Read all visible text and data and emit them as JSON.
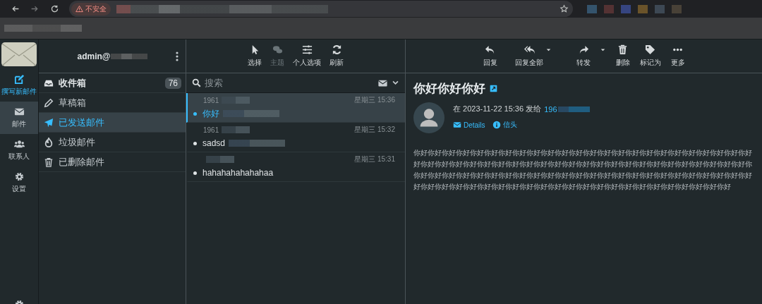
{
  "browser": {
    "security_label": "不安全"
  },
  "nav": [
    {
      "label": "撰写新邮件",
      "kind": "compose",
      "selected": false
    },
    {
      "label": "邮件",
      "kind": "mail",
      "selected": true
    },
    {
      "label": "联系人",
      "kind": "contacts",
      "selected": false
    },
    {
      "label": "设置",
      "kind": "settings",
      "selected": false
    }
  ],
  "account": "admin@",
  "folders": [
    {
      "label": "收件箱",
      "kind": "inbox",
      "count": "76",
      "unread": true,
      "selected": false
    },
    {
      "label": "草稿箱",
      "kind": "drafts",
      "unread": false,
      "selected": false
    },
    {
      "label": "已发送邮件",
      "kind": "sent",
      "unread": false,
      "selected": true
    },
    {
      "label": "垃圾邮件",
      "kind": "junk",
      "unread": false,
      "selected": false
    },
    {
      "label": "已删除邮件",
      "kind": "trash",
      "unread": false,
      "selected": false
    }
  ],
  "list_toolbar": [
    {
      "label": "选择",
      "kind": "select",
      "disabled": false
    },
    {
      "label": "主题",
      "kind": "threads",
      "disabled": true
    },
    {
      "label": "个人选项",
      "kind": "options",
      "disabled": false
    },
    {
      "label": "刷新",
      "kind": "refresh",
      "disabled": false
    }
  ],
  "search": {
    "placeholder": "搜索"
  },
  "messages": [
    {
      "from": "1961",
      "date": "星期三 15:36",
      "subject": "你好",
      "selected": true
    },
    {
      "from": "1961",
      "date": "星期三 15:32",
      "subject": "sadsd",
      "selected": false
    },
    {
      "date": "星期三 15:31",
      "subject": "hahahahahahahaa",
      "selected": false
    }
  ],
  "message_toolbar": [
    {
      "label": "回复",
      "kind": "reply",
      "dropdown": false
    },
    {
      "label": "回复全部",
      "kind": "reply-all",
      "dropdown": true
    },
    {
      "label": "转发",
      "kind": "forward",
      "dropdown": true
    },
    {
      "label": "删除",
      "kind": "delete",
      "dropdown": false
    },
    {
      "label": "标记为",
      "kind": "tag",
      "dropdown": false
    },
    {
      "label": "更多",
      "kind": "more",
      "dropdown": false
    }
  ],
  "message": {
    "subject": "你好你好你好",
    "meta": "在 2023-11-22 15:36 发给",
    "recipient": "196",
    "links": [
      "Details",
      "信头"
    ],
    "body_lines": [
      "你好你好你好你好你好你好你好你好你好你好你好你好你好你好你好你好你好你好你好你好你好你好你好你好",
      "好你好你好你好你好你好你好你好你好你好你好你好你好你好你好你好你好你好你好你好你好你好你好你好你",
      "你好你好你好你好你好你好你好你好你好你好你好你好你好你好你好你好你好你好你好你好你好你好你好你好",
      "好你好你好你好你好你好你好你好你好你好你好你好你好你好你好你好你好你好你好你好你好你好你好"
    ]
  }
}
